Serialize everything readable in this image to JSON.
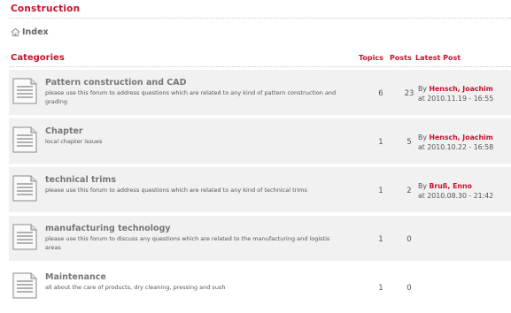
{
  "section": {
    "title": "Construction"
  },
  "breadcrumb": {
    "label": "Index"
  },
  "table": {
    "title": "Categories",
    "col_topics": "Topics",
    "col_posts": "Posts",
    "col_latest": "Latest Post"
  },
  "forums": [
    {
      "name": "Pattern construction and CAD",
      "description": "please use this forum to address questions which are related to any kind of pattern construction and grading",
      "topics": "6",
      "posts": "23",
      "by": "By",
      "author": "Hensch, Joachim",
      "date": "at 2010.11.19 - 16:55"
    },
    {
      "name": "Chapter",
      "description": "local chapter issues",
      "topics": "1",
      "posts": "5",
      "by": "By",
      "author": "Hensch, Joachim",
      "date": "at 2010.10.22 - 16:58"
    },
    {
      "name": "technical trims",
      "description": "please use this forum to address questions which are related to any kind of technical trims",
      "topics": "1",
      "posts": "2",
      "by": "By",
      "author": "Bruß, Enno",
      "date": "at 2010.08.30 - 21:42"
    },
    {
      "name": "manufacturing technology",
      "description": "please use this forum to discuss any questions which are related to the manufacturing and logistis areas",
      "topics": "1",
      "posts": "0",
      "by": "",
      "author": "",
      "date": ""
    },
    {
      "name": "Maintenance",
      "description": "all about the care of products, dry cleaning, pressing and sush",
      "topics": "1",
      "posts": "0",
      "by": "",
      "author": "",
      "date": ""
    }
  ],
  "colors": {
    "accent": "#c8102e",
    "row_shade": "#f1f1f1"
  },
  "icons": {
    "home": "home-icon",
    "forum": "forum-document-icon"
  }
}
